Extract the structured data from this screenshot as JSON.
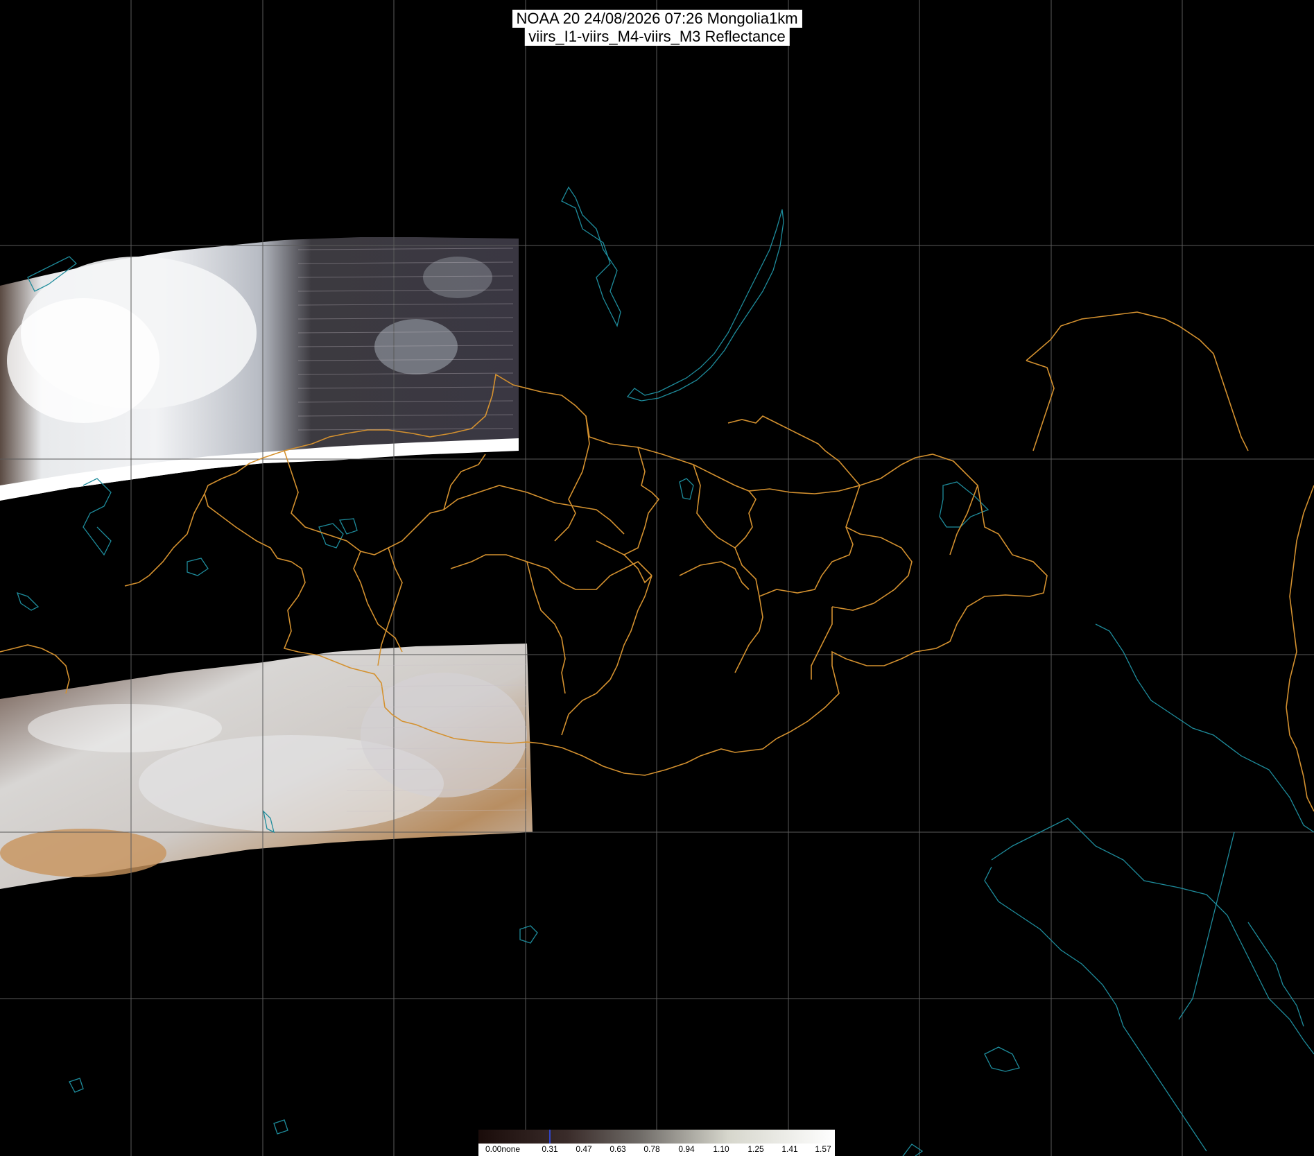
{
  "title": {
    "line1": "NOAA 20 24/08/2026 07:26 Mongolia1km",
    "line2": "viirs_I1-viirs_M4-viirs_M3 Reflectance"
  },
  "colorbar": {
    "labels": [
      "0.00none",
      "0.31",
      "0.47",
      "0.63",
      "0.78",
      "0.94",
      "1.10",
      "1.25",
      "1.41",
      "1.57"
    ]
  },
  "colors": {
    "background": "#000000",
    "graticule": "#5a5a5a",
    "border": "#d4912f",
    "coastline": "#1e8c9c"
  }
}
